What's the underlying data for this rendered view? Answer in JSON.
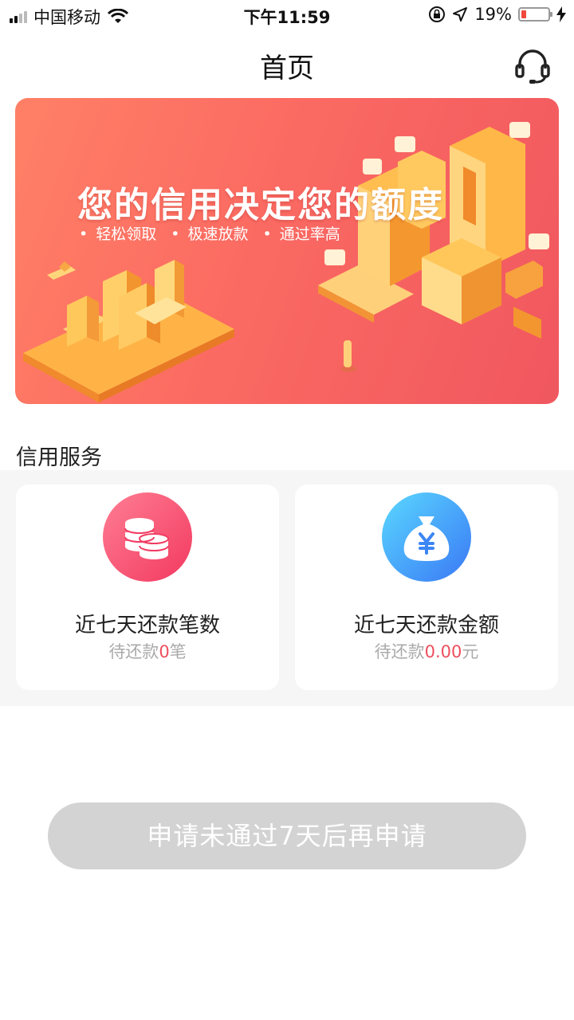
{
  "status_bar": {
    "carrier": "中国移动",
    "time": "下午11:59",
    "battery_percent": "19%",
    "battery_level": 0.19,
    "icons": [
      "signal-icon",
      "wifi-icon",
      "orientation-lock-icon",
      "location-icon",
      "battery-icon",
      "charging-icon"
    ]
  },
  "nav": {
    "title": "首页",
    "right_icon": "headset-icon"
  },
  "banner": {
    "headline": "您的信用决定您的额度",
    "bullets": [
      "轻松领取",
      "极速放款",
      "通过率高"
    ]
  },
  "credit_service": {
    "section_title": "信用服务",
    "cards": [
      {
        "icon": "coins-icon",
        "label": "近七天还款笔数",
        "sub_prefix": "待还款",
        "sub_value": "0",
        "sub_suffix": "笔"
      },
      {
        "icon": "money-bag-icon",
        "label": "近七天还款金额",
        "sub_prefix": "待还款",
        "sub_value": "0.00",
        "sub_suffix": "元"
      }
    ]
  },
  "apply_button": {
    "label": "申请未通过7天后再申请",
    "enabled": false
  },
  "colors": {
    "banner_start": "#ff8066",
    "banner_end": "#f0575f",
    "accent_red": "#ee4e5c",
    "button_disabled": "#d3d3d3",
    "coin_icon_bg": "#f23960",
    "bag_icon_bg": "#3a78f5"
  }
}
